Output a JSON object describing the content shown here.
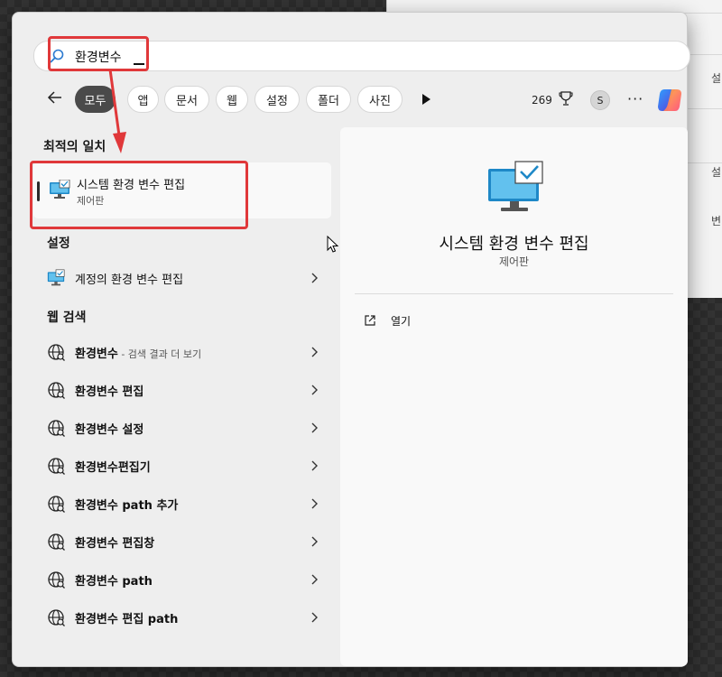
{
  "search": {
    "query": "환경변수"
  },
  "filters": {
    "chips": [
      "모두",
      "앱",
      "문서",
      "웹",
      "설정",
      "폴더",
      "사진"
    ],
    "active": "모두",
    "points": "269",
    "avatar_initial": "S"
  },
  "best_match": {
    "header": "최적의 일치",
    "title": "시스템 환경 변수 편집",
    "subtitle": "제어판"
  },
  "settings": {
    "header": "설정",
    "items": [
      {
        "label": "계정의 환경 변수 편집"
      }
    ]
  },
  "web": {
    "header": "웹 검색",
    "items": [
      {
        "bold": "환경변수",
        "suffix": " - 검색 결과 더 보기"
      },
      {
        "bold": "환경변수 편집"
      },
      {
        "bold": "환경변수 설정"
      },
      {
        "bold": "환경변수편집기"
      },
      {
        "bold": "환경변수 path 추가"
      },
      {
        "bold": "환경변수 편집창"
      },
      {
        "bold": "환경변수 path"
      },
      {
        "bold": "환경변수 편집 path"
      }
    ]
  },
  "detail": {
    "title": "시스템 환경 변수 편집",
    "subtitle": "제어판",
    "action_open": "열기"
  },
  "background_window": {
    "peek": [
      "설",
      "설",
      "변"
    ]
  },
  "colors": {
    "annotation": "#e0383a",
    "panel": "#eeeeee",
    "active_chip": "#4a4a4a",
    "monitor": "#1e88c7"
  },
  "icons": {
    "search": "search-icon",
    "back": "back-arrow-icon",
    "trophy": "trophy-icon",
    "more": "more-icon",
    "copilot": "copilot-icon",
    "system": "monitor-check-icon",
    "web": "globe-icon",
    "chevron": "chevron-right-icon",
    "open": "open-external-icon"
  }
}
